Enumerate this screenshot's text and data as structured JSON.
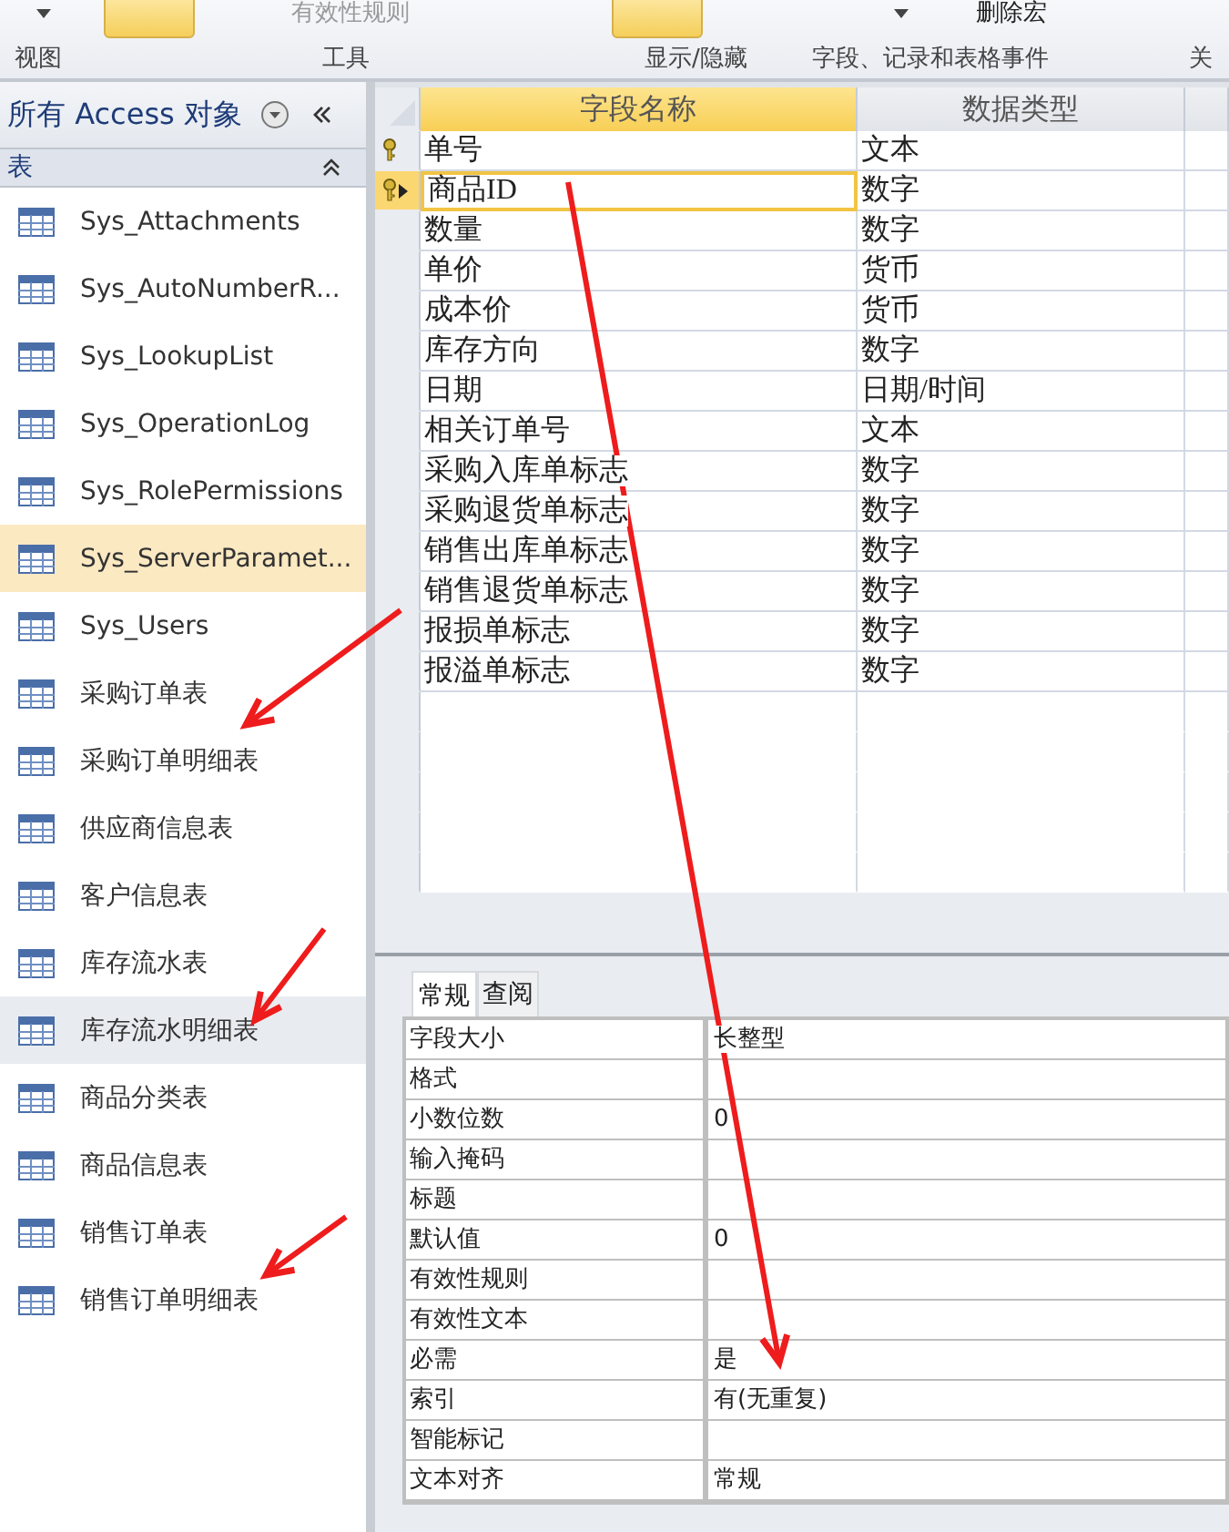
{
  "ribbon": {
    "items": [
      {
        "kind": "big"
      },
      {
        "kind": "text",
        "label": "有效性规则"
      },
      {
        "kind": "big"
      },
      {
        "kind": "text",
        "label": "删除宏"
      }
    ],
    "groups": [
      {
        "label": "视图"
      },
      {
        "label": "工具"
      },
      {
        "label": "显示/隐藏"
      },
      {
        "label": "字段、记录和表格事件"
      },
      {
        "label": "关"
      }
    ]
  },
  "nav": {
    "title": "所有 Access 对象",
    "section": "表",
    "items": [
      {
        "label": "Sys_Attachments",
        "selected": false,
        "hovered": false
      },
      {
        "label": "Sys_AutoNumberR...",
        "selected": false,
        "hovered": false
      },
      {
        "label": "Sys_LookupList",
        "selected": false,
        "hovered": false
      },
      {
        "label": "Sys_OperationLog",
        "selected": false,
        "hovered": false
      },
      {
        "label": "Sys_RolePermissions",
        "selected": false,
        "hovered": false
      },
      {
        "label": "Sys_ServerParamet...",
        "selected": true,
        "hovered": false
      },
      {
        "label": "Sys_Users",
        "selected": false,
        "hovered": false
      },
      {
        "label": "采购订单表",
        "selected": false,
        "hovered": false
      },
      {
        "label": "采购订单明细表",
        "selected": false,
        "hovered": false
      },
      {
        "label": "供应商信息表",
        "selected": false,
        "hovered": false
      },
      {
        "label": "客户信息表",
        "selected": false,
        "hovered": false
      },
      {
        "label": "库存流水表",
        "selected": false,
        "hovered": false
      },
      {
        "label": "库存流水明细表",
        "selected": false,
        "hovered": true
      },
      {
        "label": "商品分类表",
        "selected": false,
        "hovered": false
      },
      {
        "label": "商品信息表",
        "selected": false,
        "hovered": false
      },
      {
        "label": "销售订单表",
        "selected": false,
        "hovered": false
      },
      {
        "label": "销售订单明细表",
        "selected": false,
        "hovered": false
      }
    ]
  },
  "grid": {
    "columns": [
      "字段名称",
      "数据类型"
    ],
    "rows": [
      {
        "name": "单号",
        "type": "文本",
        "primary_key": true,
        "current": false
      },
      {
        "name": "商品ID",
        "type": "数字",
        "primary_key": true,
        "current": true
      },
      {
        "name": "数量",
        "type": "数字",
        "primary_key": false,
        "current": false
      },
      {
        "name": "单价",
        "type": "货币",
        "primary_key": false,
        "current": false
      },
      {
        "name": "成本价",
        "type": "货币",
        "primary_key": false,
        "current": false
      },
      {
        "name": "库存方向",
        "type": "数字",
        "primary_key": false,
        "current": false
      },
      {
        "name": "日期",
        "type": "日期/时间",
        "primary_key": false,
        "current": false
      },
      {
        "name": "相关订单号",
        "type": "文本",
        "primary_key": false,
        "current": false
      },
      {
        "name": "采购入库单标志",
        "type": "数字",
        "primary_key": false,
        "current": false
      },
      {
        "name": "采购退货单标志",
        "type": "数字",
        "primary_key": false,
        "current": false
      },
      {
        "name": "销售出库单标志",
        "type": "数字",
        "primary_key": false,
        "current": false
      },
      {
        "name": "销售退货单标志",
        "type": "数字",
        "primary_key": false,
        "current": false
      },
      {
        "name": "报损单标志",
        "type": "数字",
        "primary_key": false,
        "current": false
      },
      {
        "name": "报溢单标志",
        "type": "数字",
        "primary_key": false,
        "current": false
      }
    ]
  },
  "properties": {
    "tabs": [
      {
        "label": "常规",
        "selected": true
      },
      {
        "label": "查阅",
        "selected": false
      }
    ],
    "rows": [
      {
        "name": "字段大小",
        "value": "长整型"
      },
      {
        "name": "格式",
        "value": ""
      },
      {
        "name": "小数位数",
        "value": "0"
      },
      {
        "name": "输入掩码",
        "value": ""
      },
      {
        "name": "标题",
        "value": ""
      },
      {
        "name": "默认值",
        "value": "0"
      },
      {
        "name": "有效性规则",
        "value": ""
      },
      {
        "name": "有效性文本",
        "value": ""
      },
      {
        "name": "必需",
        "value": "是"
      },
      {
        "name": "索引",
        "value": "有(无重复)"
      },
      {
        "name": "智能标记",
        "value": ""
      },
      {
        "name": "文本对齐",
        "value": "常规"
      }
    ]
  },
  "annotations": [
    {
      "kind": "arrow"
    },
    {
      "kind": "arrow"
    },
    {
      "kind": "arrow"
    },
    {
      "kind": "arrow"
    }
  ]
}
